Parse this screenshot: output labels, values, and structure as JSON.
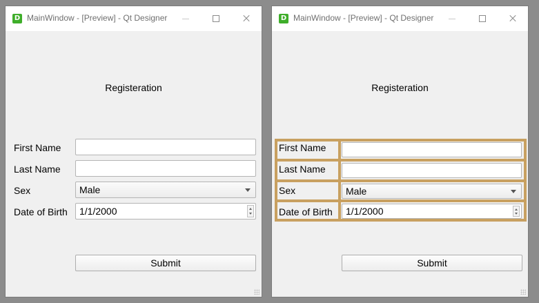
{
  "window": {
    "title": "MainWindow - [Preview] - Qt Designer",
    "icon_letter": "D",
    "icon_name": "qt-designer-app-icon",
    "accent": "#3fae2a"
  },
  "form": {
    "heading": "Registeration",
    "first_name_label": "First Name",
    "first_name_value": "",
    "last_name_label": "Last Name",
    "last_name_value": "",
    "sex_label": "Sex",
    "sex_value": "Male",
    "dob_label": "Date of Birth",
    "dob_value": "1/1/2000",
    "submit_label": "Submit"
  },
  "layout_highlight_color": "#c8a060"
}
